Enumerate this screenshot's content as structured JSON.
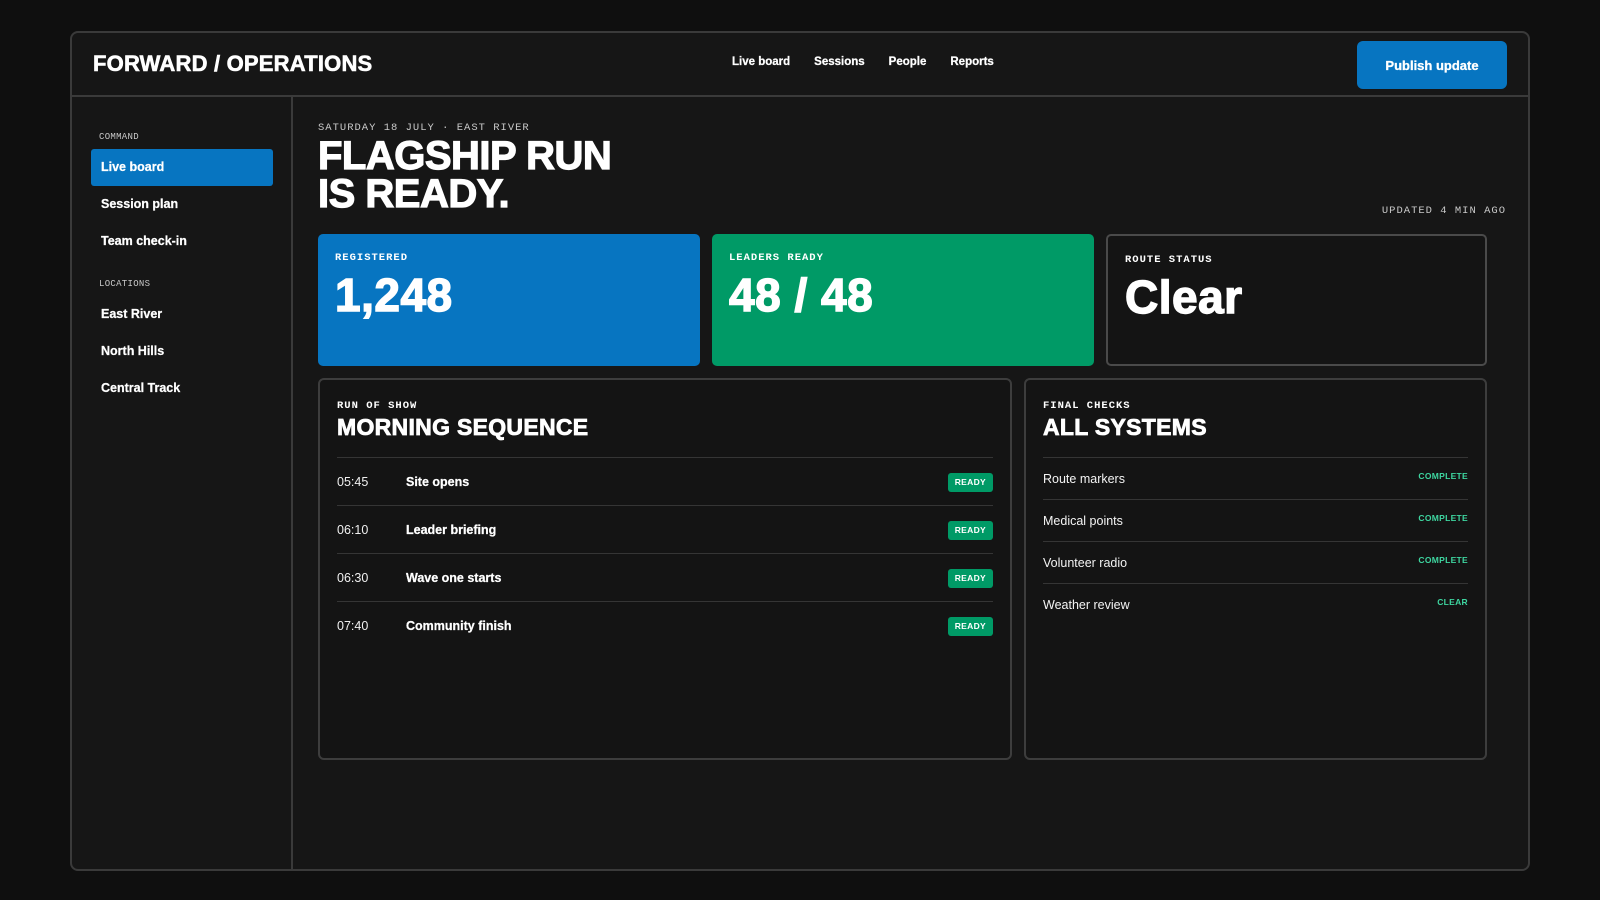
{
  "header": {
    "brand": "FORWARD / OPERATIONS",
    "nav": [
      "Live board",
      "Sessions",
      "People",
      "Reports"
    ],
    "publish_label": "Publish update"
  },
  "sidebar": {
    "command_heading": "COMMAND",
    "command_items": [
      "Live board",
      "Session plan",
      "Team check-in"
    ],
    "locations_heading": "LOCATIONS",
    "location_items": [
      "East River",
      "North Hills",
      "Central Track"
    ],
    "active_item": "Live board"
  },
  "main": {
    "eyebrow": "SATURDAY 18 JULY · EAST RIVER",
    "hero_line1": "FLAGSHIP RUN",
    "hero_line2": "IS READY.",
    "updated": "UPDATED 4 MIN AGO"
  },
  "stats": [
    {
      "label": "REGISTERED",
      "value": "1,248"
    },
    {
      "label": "LEADERS READY",
      "value": "48 / 48"
    },
    {
      "label": "ROUTE STATUS",
      "value": "Clear"
    }
  ],
  "sequence": {
    "eyebrow": "RUN OF SHOW",
    "title": "MORNING SEQUENCE",
    "rows": [
      {
        "time": "05:45",
        "name": "Site opens",
        "status": "READY"
      },
      {
        "time": "06:10",
        "name": "Leader briefing",
        "status": "READY"
      },
      {
        "time": "06:30",
        "name": "Wave one starts",
        "status": "READY"
      },
      {
        "time": "07:40",
        "name": "Community finish",
        "status": "READY"
      }
    ]
  },
  "checks": {
    "eyebrow": "FINAL CHECKS",
    "title": "ALL SYSTEMS",
    "rows": [
      {
        "name": "Route markers",
        "status": "COMPLETE"
      },
      {
        "name": "Medical points",
        "status": "COMPLETE"
      },
      {
        "name": "Volunteer radio",
        "status": "COMPLETE"
      },
      {
        "name": "Weather review",
        "status": "CLEAR"
      }
    ]
  },
  "colors": {
    "accent_blue": "#0775c1",
    "accent_green": "#009a66",
    "status_text_green": "#3ed6a0",
    "background": "#161616"
  }
}
